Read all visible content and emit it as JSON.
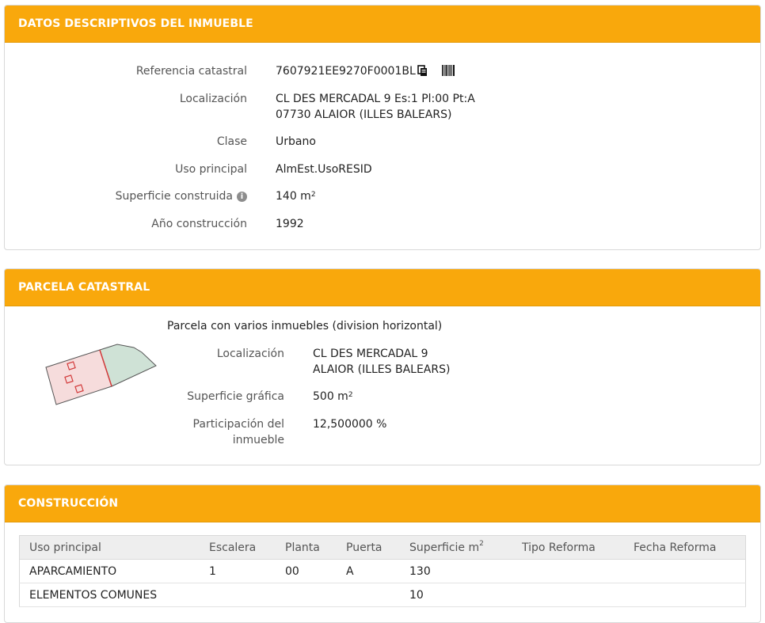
{
  "datos": {
    "title": "DATOS DESCRIPTIVOS DEL INMUEBLE",
    "referencia_label": "Referencia catastral",
    "referencia_value": "7607921EE9270F0001BL",
    "localizacion_label": "Localización",
    "localizacion_line1": "CL DES MERCADAL 9 Es:1 Pl:00 Pt:A",
    "localizacion_line2": "07730 ALAIOR (ILLES BALEARS)",
    "clase_label": "Clase",
    "clase_value": "Urbano",
    "uso_label": "Uso principal",
    "uso_value": "AlmEst.UsoRESID",
    "superficie_label": "Superficie construida",
    "superficie_value": "140 m",
    "superficie_unit_sup": "2",
    "anio_label": "Año construcción",
    "anio_value": "1992",
    "icons": [
      "copy-icon",
      "barcode-icon",
      "info-icon"
    ]
  },
  "parcela": {
    "title": "PARCELA CATASTRAL",
    "subtitle": "Parcela con varios inmuebles (division horizontal)",
    "localizacion_label": "Localización",
    "localizacion_line1": "CL DES MERCADAL 9",
    "localizacion_line2": "ALAIOR (ILLES BALEARS)",
    "superficie_label": "Superficie gráfica",
    "superficie_value": "500 m",
    "superficie_unit_sup": "2",
    "participacion_label_1": "Participación del",
    "participacion_label_2": "inmueble",
    "participacion_value": "12,500000 %",
    "colors": {
      "parcel_fill": "#f6dcdc",
      "parcel_outline": "#d23b3b",
      "neighbor_fill": "#cfe2d6"
    }
  },
  "construccion": {
    "title": "CONSTRUCCIÓN",
    "columns": [
      "Uso principal",
      "Escalera",
      "Planta",
      "Puerta",
      "Superficie m",
      "Tipo Reforma",
      "Fecha Reforma"
    ],
    "superficie_unit_sup": "2",
    "rows": [
      [
        "APARCAMIENTO",
        "1",
        "00",
        "A",
        "130",
        "",
        ""
      ],
      [
        "ELEMENTOS COMUNES",
        "",
        "",
        "",
        "10",
        "",
        ""
      ]
    ]
  },
  "theme": {
    "accent": "#f9a80c",
    "header_text": "#ffffff"
  }
}
